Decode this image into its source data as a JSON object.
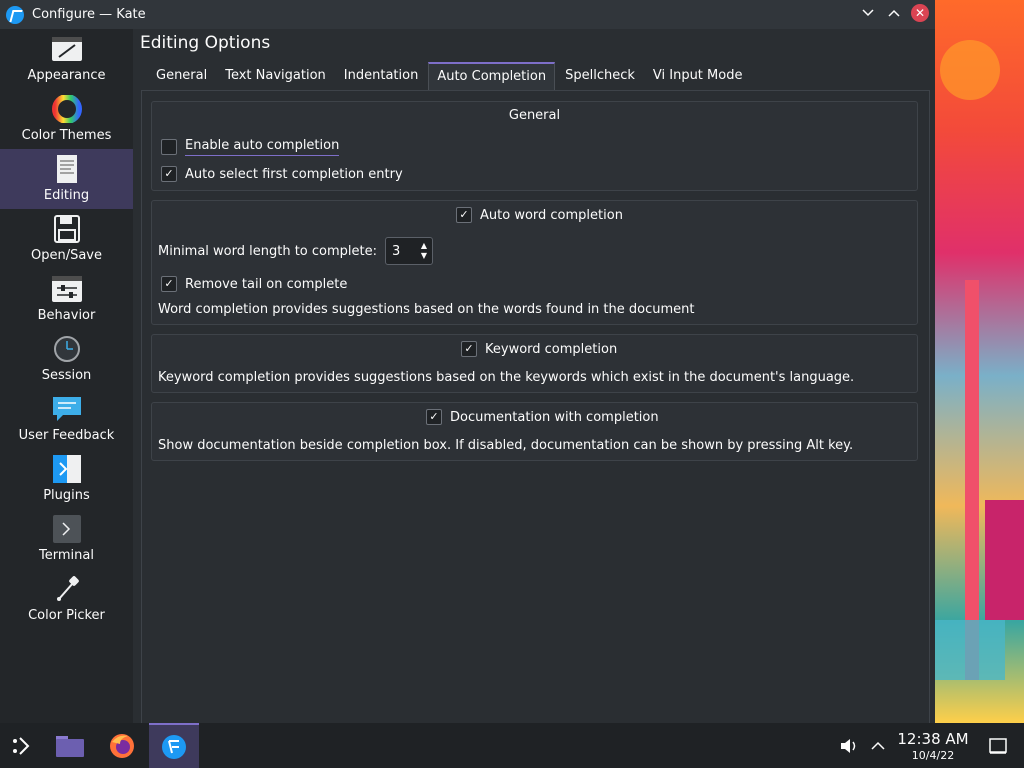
{
  "window": {
    "title": "Configure — Kate",
    "controls": {
      "minimize": "⌵",
      "maximize": "⌃",
      "close": "✕"
    }
  },
  "sidebar": {
    "items": [
      {
        "label": "Appearance",
        "icon": "appearance-icon",
        "selected": false
      },
      {
        "label": "Color Themes",
        "icon": "color-themes-icon",
        "selected": false
      },
      {
        "label": "Editing",
        "icon": "editing-icon",
        "selected": true
      },
      {
        "label": "Open/Save",
        "icon": "open-save-icon",
        "selected": false
      },
      {
        "label": "Behavior",
        "icon": "behavior-icon",
        "selected": false
      },
      {
        "label": "Session",
        "icon": "session-icon",
        "selected": false
      },
      {
        "label": "User Feedback",
        "icon": "user-feedback-icon",
        "selected": false
      },
      {
        "label": "Plugins",
        "icon": "plugins-icon",
        "selected": false
      },
      {
        "label": "Terminal",
        "icon": "terminal-icon",
        "selected": false
      },
      {
        "label": "Color Picker",
        "icon": "color-picker-icon",
        "selected": false
      }
    ]
  },
  "main": {
    "title": "Editing Options",
    "tabs": [
      {
        "label": "General",
        "active": false
      },
      {
        "label": "Text Navigation",
        "active": false
      },
      {
        "label": "Indentation",
        "active": false
      },
      {
        "label": "Auto Completion",
        "active": true
      },
      {
        "label": "Spellcheck",
        "active": false
      },
      {
        "label": "Vi Input Mode",
        "active": false
      }
    ],
    "general_group": {
      "title": "General",
      "enable_auto_completion": {
        "label": "Enable auto completion",
        "checked": false
      },
      "auto_select_first": {
        "label": "Auto select first completion entry",
        "checked": true
      }
    },
    "word_group": {
      "title": {
        "label": "Auto word completion",
        "checked": true
      },
      "min_length_label": "Minimal word length to complete:",
      "min_length_value": "3",
      "remove_tail": {
        "label": "Remove tail on complete",
        "checked": true
      },
      "description": "Word completion provides suggestions based on the words found in the document"
    },
    "keyword_group": {
      "title": {
        "label": "Keyword completion",
        "checked": true
      },
      "description": "Keyword completion provides suggestions based on the keywords which exist in the document's language."
    },
    "doc_group": {
      "title": {
        "label": "Documentation with completion",
        "checked": true
      },
      "description": "Show documentation beside completion box. If disabled, documentation can be shown by pressing Alt key."
    }
  },
  "taskbar": {
    "clock_time": "12:38 AM",
    "clock_date": "10/4/22"
  },
  "colors": {
    "accent": "#7e6fc9",
    "selection": "#3e3a5c",
    "close": "#da4453"
  }
}
